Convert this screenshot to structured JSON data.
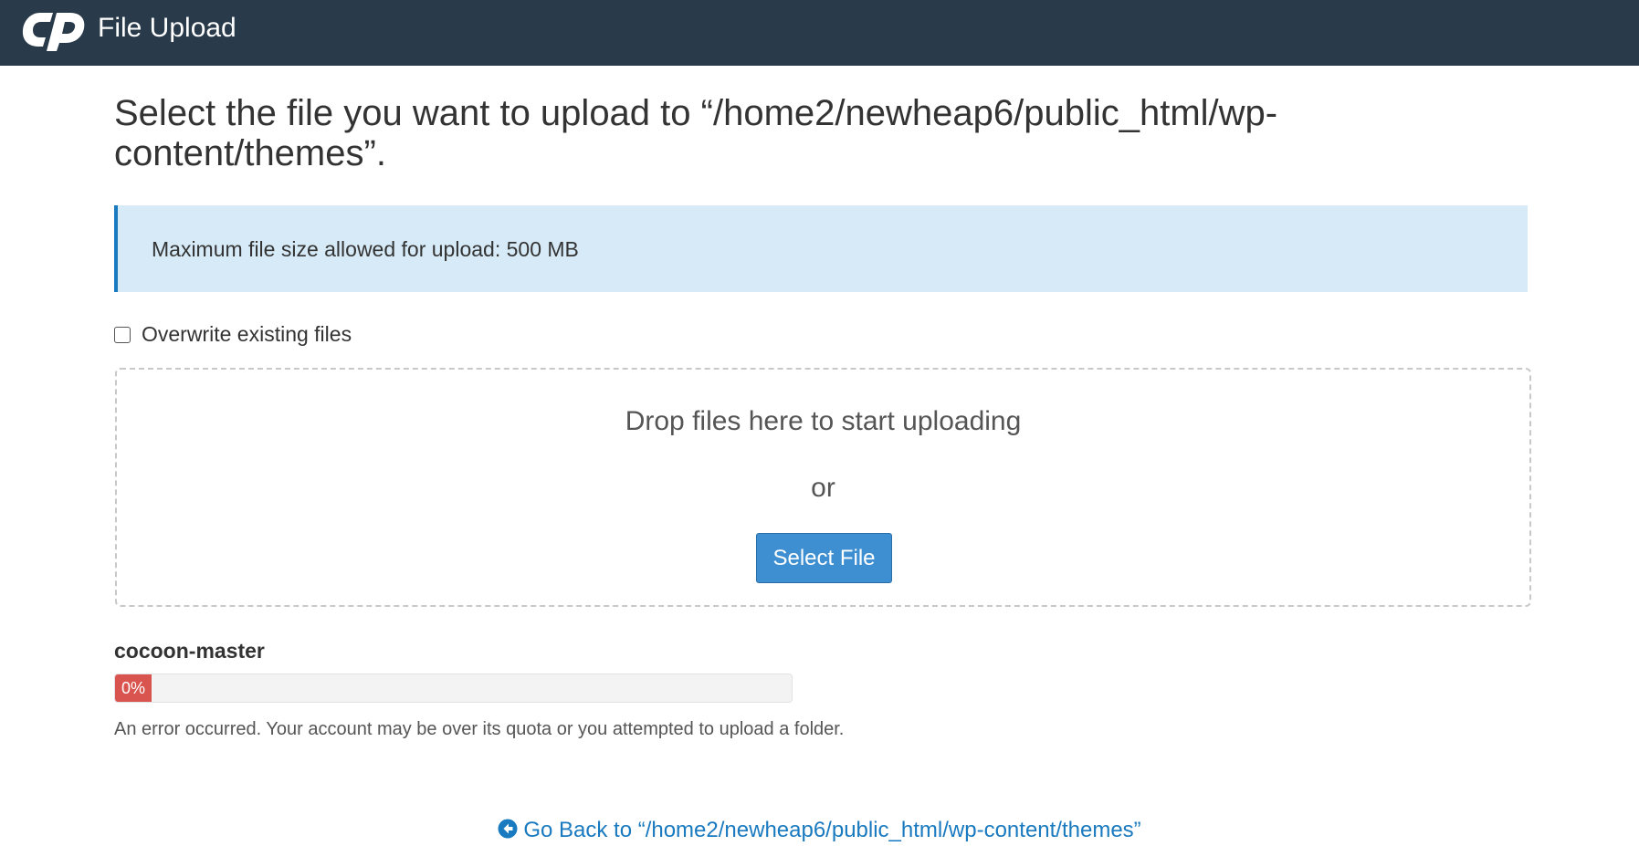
{
  "header": {
    "logo_icon": "cpanel-logo-icon",
    "title": "File Upload",
    "background_color": "#293a4a"
  },
  "main": {
    "page_title": "Select the file you want to upload to “/home2/newheap6/public_html/wp-content/themes”.",
    "info_message": "Maximum file size allowed for upload: 500 MB",
    "overwrite": {
      "label": "Overwrite existing files",
      "checked": false
    },
    "dropzone": {
      "drop_text": "Drop files here to start uploading",
      "or_text": "or",
      "select_button_label": "Select File"
    },
    "upload": {
      "file_name": "cocoon-master",
      "progress_label": "0%",
      "progress_value": 0,
      "status_color": "#d9534f",
      "error_message": "An error occurred. Your account may be over its quota or you attempted to upload a folder."
    },
    "go_back": {
      "icon": "arrow-circle-left-icon",
      "label": "Go Back to “/home2/newheap6/public_html/wp-content/themes”"
    }
  },
  "colors": {
    "accent": "#1a7abf",
    "button": "#3d8fd1",
    "info_background": "#d6ebf7"
  }
}
